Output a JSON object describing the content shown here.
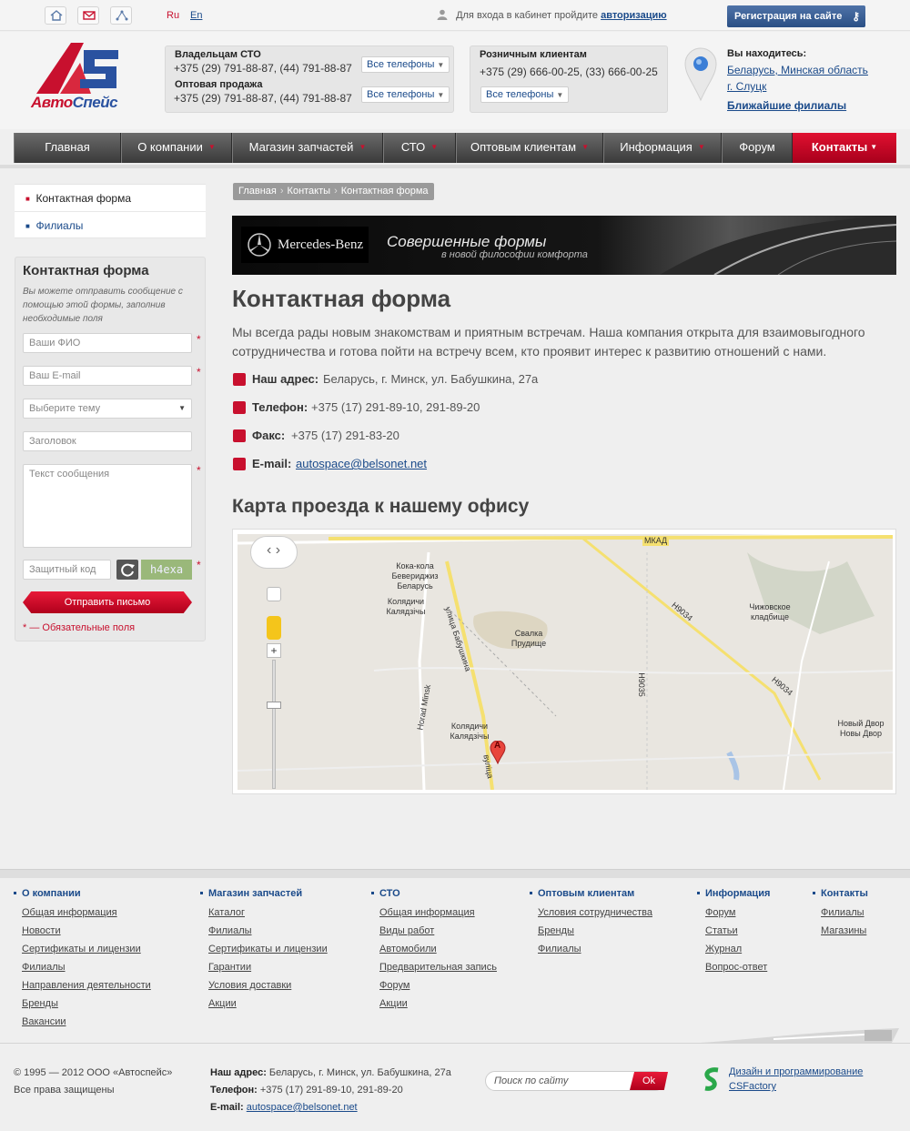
{
  "topbar": {
    "lang_ru": "Ru",
    "lang_en": "En",
    "login_prefix": "Для входа в кабинет пройдите",
    "login_link": "авторизацию",
    "register": "Регистрация на сайте"
  },
  "logo": {
    "part1": "Авто",
    "part2": "Спейс"
  },
  "phones": {
    "sto_title": "Владельцам СТО",
    "sto_num": "+375 (29) 791-88-87, (44) 791-88-87",
    "wholesale_title": "Оптовая продажа",
    "wholesale_num": "+375 (29) 791-88-87, (44) 791-88-87",
    "retail_title": "Розничным клиентам",
    "retail_num": "+375 (29) 666-00-25, (33) 666-00-25",
    "all_phones": "Все телефоны"
  },
  "location": {
    "title": "Вы находитесь:",
    "addr1": "Беларусь, Минская область",
    "addr2": "г. Слуцк",
    "nearest": "Ближайшие филиалы"
  },
  "nav": [
    "Главная",
    "О компании",
    "Магазин запчастей",
    "СТО",
    "Оптовым клиентам",
    "Информация",
    "Форум",
    "Контакты"
  ],
  "sidebar": {
    "menu": [
      "Контактная форма",
      "Филиалы"
    ],
    "form_title": "Контактная форма",
    "form_desc": "Вы можете отправить сообщение с помощью этой формы, заполнив необходимые поля",
    "name_ph": "Ваши ФИО",
    "email_ph": "Ваш E-mail",
    "topic_ph": "Выберите тему",
    "subject_ph": "Заголовок",
    "message_ph": "Текст сообщения",
    "captcha_ph": "Защитный код",
    "captcha_text": "h4exa",
    "submit": "Отправить письмо",
    "required_note": "* — Обязательные поля",
    "req_mark": "*"
  },
  "breadcrumb": [
    "Главная",
    "Контакты",
    "Контактная форма"
  ],
  "banner": {
    "brand": "Mercedes-Benz",
    "main": "Совершенные формы",
    "sub": "в новой философии комфорта"
  },
  "content": {
    "title": "Контактная форма",
    "intro": "Мы всегда рады новым знакомствам и приятным встречам. Наша компания открыта для взаимовыгодного сотрудничества и готова пойти на встречу всем, кто проявит интерес к развитию отношений с нами.",
    "address_label": "Наш адрес:",
    "address": "Беларусь, г. Минск, ул. Бабушкина, 27а",
    "phone_label": "Телефон:",
    "phone": "+375 (17) 291-89-10, 291-89-20",
    "fax_label": "Факс:",
    "fax": "+375 (17) 291-83-20",
    "email_label": "E-mail:",
    "email": "autospace@belsonet.net",
    "map_title": "Карта проезда к нашему офису"
  },
  "map": {
    "mkad": "МКАД",
    "coca": "Кока-кола Бевериджиз Беларусь",
    "kolyadichi1": "Колядичи Калядзічы",
    "svalka": "Свалка Прудище",
    "chizh": "Чижовское кладбище",
    "h9034a": "H9034",
    "h9034b": "H9034",
    "h9035": "H9035",
    "babushkina": "улица Бабушкина",
    "horad": "Horad Minsk",
    "kolyadichi2": "Колядичи Калядзічы",
    "novy": "Новый Двор Новы Двор",
    "vulica": "вуліца",
    "marker": "A"
  },
  "footer": {
    "cols": [
      {
        "head": "О компании",
        "links": [
          "Общая информация",
          "Новости",
          "Сертификаты и лицензии",
          "Филиалы",
          "Направления деятельности",
          "Бренды",
          "Вакансии"
        ]
      },
      {
        "head": "Магазин запчастей",
        "links": [
          "Каталог",
          "Филиалы",
          "Сертификаты и лицензии",
          "Гарантии",
          "Условия доставки",
          "Акции"
        ]
      },
      {
        "head": "СТО",
        "links": [
          "Общая информация",
          "Виды работ",
          "Автомобили",
          "Предварительная запись",
          "Форум",
          "Акции"
        ]
      },
      {
        "head": "Оптовым клиентам",
        "links": [
          "Условия сотрудничества",
          "Бренды",
          "Филиалы"
        ]
      },
      {
        "head": "Информация",
        "links": [
          "Форум",
          "Статьи",
          "Журнал",
          "Вопрос-ответ"
        ]
      },
      {
        "head": "Контакты",
        "links": [
          "Филиалы",
          "Магазины"
        ]
      }
    ],
    "copyright": "© 1995 — 2012 ООО «Автоспейс»",
    "rights": "Все права защищены",
    "addr_label": "Наш адрес:",
    "addr": "Беларусь, г. Минск, ул. Бабушкина, 27а",
    "phone_label": "Телефон:",
    "phone": "+375 (17) 291-89-10, 291-89-20",
    "email_label": "E-mail:",
    "email": "autospace@belsonet.net",
    "search_ph": "Поиск по сайту",
    "search_ok": "Ok",
    "dev1": "Дизайн и программирование",
    "dev2": "CSFactory"
  },
  "colors": {
    "accent": "#c8102e",
    "link": "#1a4a8a",
    "nav": "#4a4a4a"
  }
}
